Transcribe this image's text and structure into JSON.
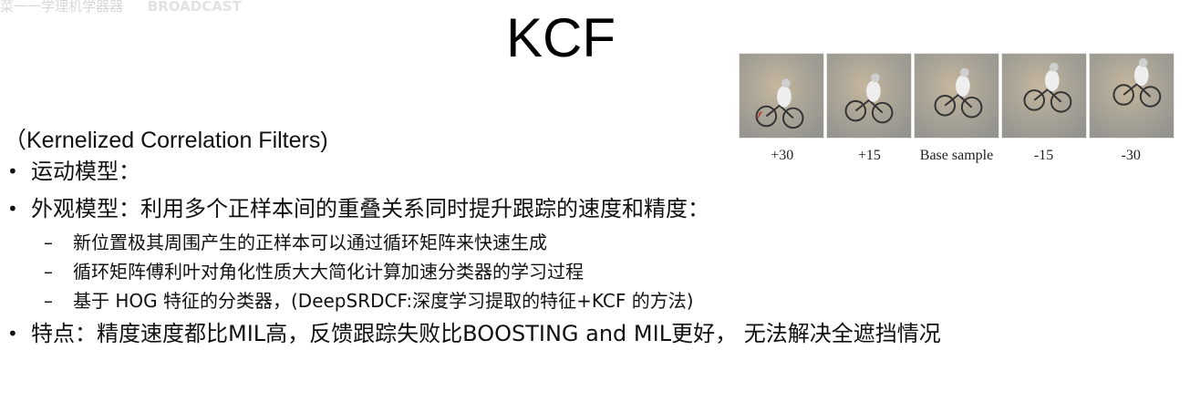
{
  "watermark": {
    "text": "菜一一学理机学器器",
    "brand": "BROADCAST"
  },
  "slide": {
    "title": "KCF",
    "subtitle": "（Kernelized Correlation Filters)"
  },
  "figure": {
    "captions": [
      "+30",
      "+15",
      "Base sample",
      "-15",
      "-30"
    ]
  },
  "bullets": [
    {
      "level": 1,
      "symbol": "•",
      "text": "运动模型："
    },
    {
      "level": 1,
      "symbol": "•",
      "text": "外观模型：利用多个正样本间的重叠关系同时提升跟踪的速度和精度："
    },
    {
      "level": 2,
      "symbol": "–",
      "text": "新位置极其周围产生的正样本可以通过循环矩阵来快速生成"
    },
    {
      "level": 2,
      "symbol": "–",
      "text": "循环矩阵傅利叶对角化性质大大简化计算加速分类器的学习过程"
    },
    {
      "level": 2,
      "symbol": "–",
      "text": "基于 HOG 特征的分类器，(DeepSRDCF:深度学习提取的特征+KCF 的方法)"
    },
    {
      "level": 1,
      "symbol": "•",
      "text": "特点：精度速度都比MIL高，反馈跟踪失败比BOOSTING and MIL更好， 无法解决全遮挡情况"
    }
  ]
}
